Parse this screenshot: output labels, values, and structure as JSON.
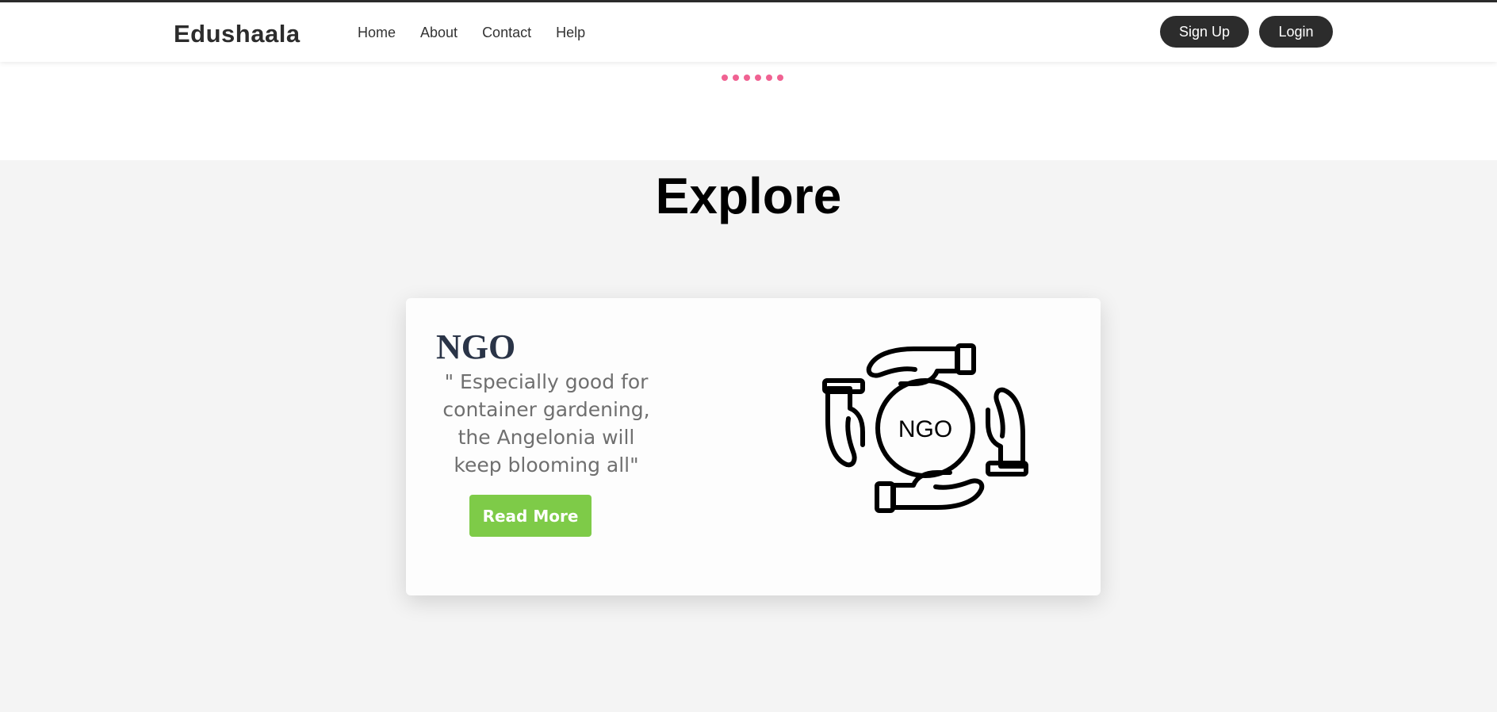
{
  "header": {
    "brand": "Edushaala",
    "nav": [
      {
        "label": "Home"
      },
      {
        "label": "About"
      },
      {
        "label": "Contact"
      },
      {
        "label": "Help"
      }
    ],
    "signup_label": "Sign Up",
    "login_label": "Login"
  },
  "loader": {
    "dot_count": 6,
    "color": "#f06292"
  },
  "explore": {
    "title": "Explore",
    "card": {
      "title": "NGO",
      "quote": "\" Especially good for container gardening, the Angelonia will keep blooming all\"",
      "button_label": "Read More",
      "logo_text": "NGO",
      "logo_icon": "ngo-hands-icon"
    }
  },
  "colors": {
    "dark": "#2c2c2c",
    "accent_green": "#7ecb48",
    "dot_pink": "#f06292",
    "page_bg": "#f4f4f4"
  }
}
